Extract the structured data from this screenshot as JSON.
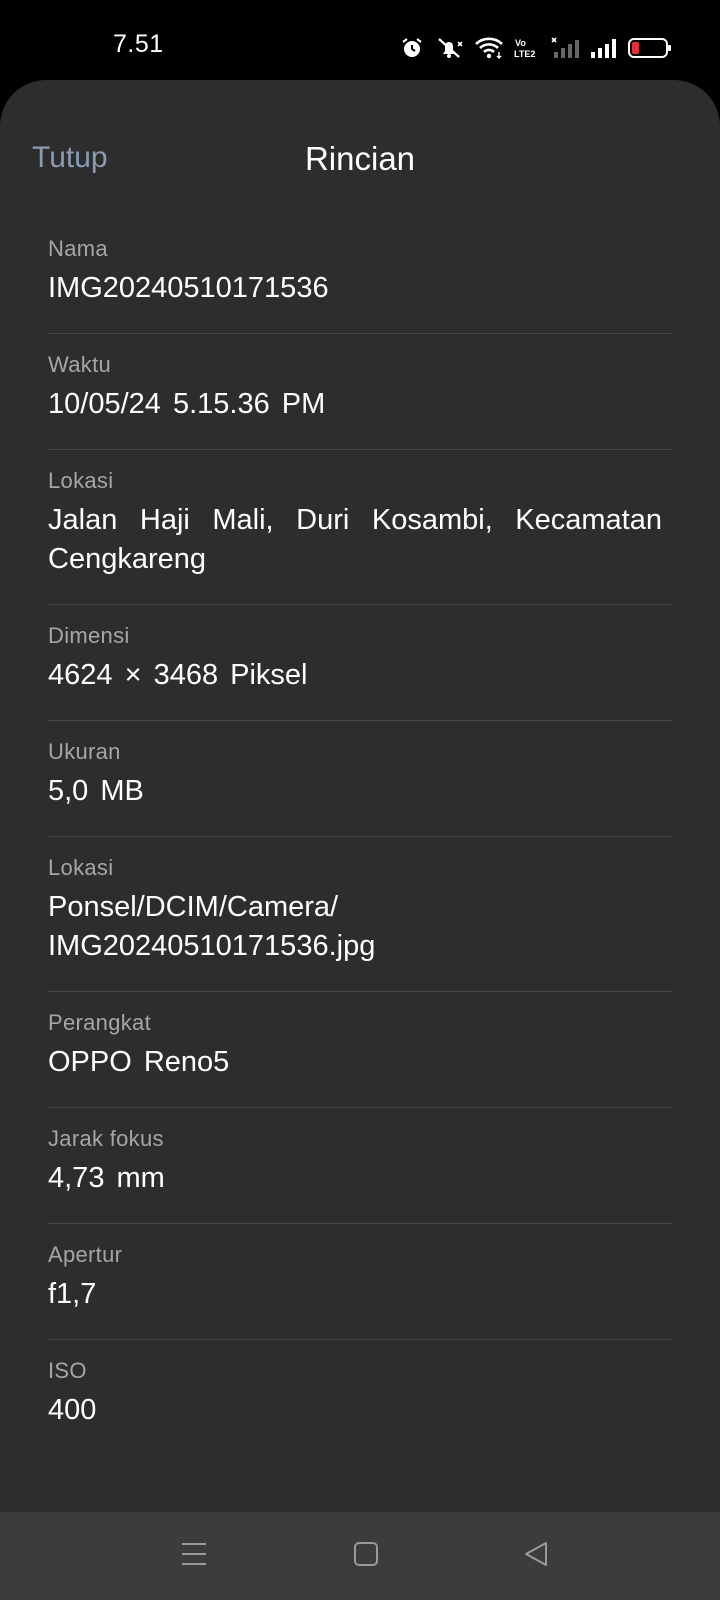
{
  "status_bar": {
    "time": "7.51",
    "icons": [
      "alarm-icon",
      "muted-bell-icon",
      "wifi-icon",
      "volte-icon",
      "signal-sim1-icon",
      "signal-sim2-icon",
      "battery-low-icon"
    ],
    "volte_label": "Vo LTE2"
  },
  "header": {
    "close_label": "Tutup",
    "title": "Rincian"
  },
  "details": [
    {
      "label": "Nama",
      "value": "IMG20240510171536"
    },
    {
      "label": "Waktu",
      "value": "10/05/24 5.15.36 PM"
    },
    {
      "label": "Lokasi",
      "value": "Jalan Haji Mali, Duri Kosambi, Kecamatan Cengkareng"
    },
    {
      "label": "Dimensi",
      "value": "4624 × 3468 Piksel"
    },
    {
      "label": "Ukuran",
      "value": "5,0 MB"
    },
    {
      "label": "Lokasi",
      "value": "Ponsel/DCIM/Camera/ IMG20240510171536.jpg"
    },
    {
      "label": "Perangkat",
      "value": "OPPO Reno5"
    },
    {
      "label": "Jarak fokus",
      "value": "4,73 mm"
    },
    {
      "label": "Apertur",
      "value": "f1,7"
    },
    {
      "label": "ISO",
      "value": "400"
    }
  ],
  "nav_bar": {
    "buttons": [
      "menu-icon",
      "home-icon",
      "back-icon"
    ]
  },
  "colors": {
    "background": "#000000",
    "sheet": "#2d2d2d",
    "close_link": "#8a9bb4",
    "label": "#a6a6a6",
    "value": "#ffffff",
    "divider": "#474747",
    "nav_bar": "#3c3c3c",
    "battery_low": "#e8303a"
  }
}
